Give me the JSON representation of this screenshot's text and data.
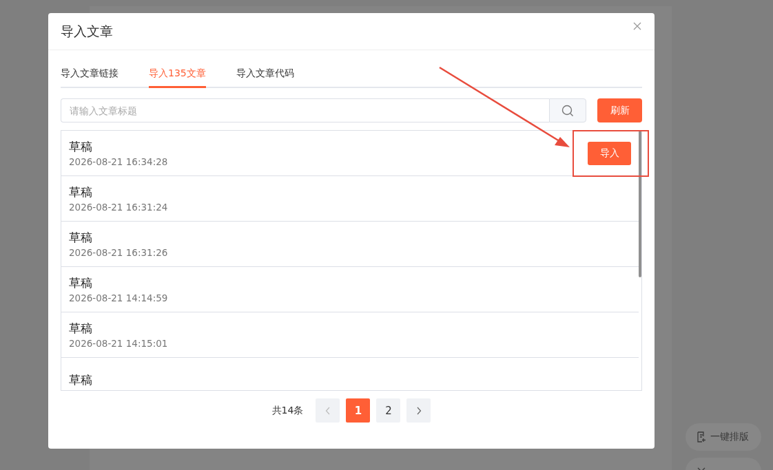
{
  "background": {
    "floating_buttons": [
      {
        "label": "一键排版",
        "kind": "document"
      },
      {
        "kind": "tools"
      }
    ]
  },
  "dialog": {
    "title": "导入文章",
    "tabs": [
      {
        "label": "导入文章链接",
        "selected": false
      },
      {
        "label": "导入135文章",
        "selected": true
      },
      {
        "label": "导入文章代码",
        "selected": false
      }
    ],
    "search": {
      "placeholder": "请输入文章标题"
    },
    "refresh_button": "刷新",
    "articles": [
      {
        "title": "草稿",
        "date": "2026-08-21 16:34:28",
        "action": "导入"
      },
      {
        "title": "草稿",
        "date": "2026-08-21 16:31:24"
      },
      {
        "title": "草稿",
        "date": "2026-08-21 16:31:26"
      },
      {
        "title": "草稿",
        "date": "2026-08-21 14:14:59"
      },
      {
        "title": "草稿",
        "date": "2026-08-21 14:15:01"
      },
      {
        "title": "草稿"
      }
    ],
    "pagination": {
      "total": "共14条",
      "pages": [
        {
          "label": "1",
          "selected": true
        },
        {
          "label": "2",
          "selected": false
        }
      ]
    }
  }
}
